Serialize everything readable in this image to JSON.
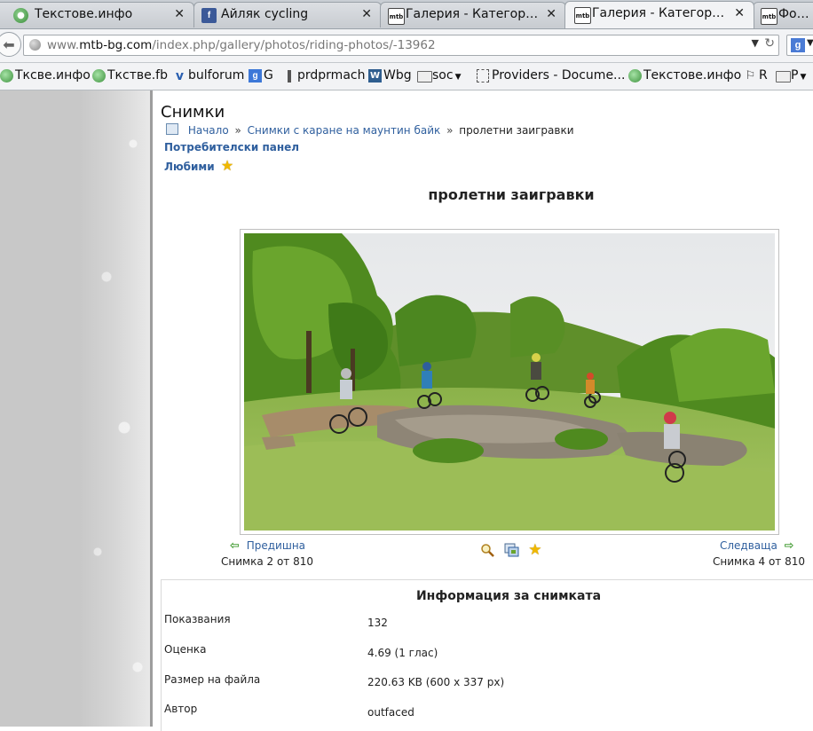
{
  "browser": {
    "tabs": [
      {
        "title": "Текстове.инфо",
        "icon": "globe-icon",
        "active": false
      },
      {
        "title": "Айляк cycling",
        "icon": "facebook-icon",
        "active": false
      },
      {
        "title": "Галерия - Категории - mtb-bg.com",
        "icon": "mtb-icon",
        "active": false
      },
      {
        "title": "Галерия - Категории - mtb-bg.com",
        "icon": "mtb-icon",
        "active": true
      },
      {
        "title": "Форум",
        "icon": "mtb-icon",
        "active": false
      }
    ],
    "url_prefix": "www.",
    "url_domain": "mtb-bg.com",
    "url_path": "/index.php/gallery/photos/riding-photos/-13962",
    "search_engine_label": "g",
    "bookmarks": [
      {
        "label": "Ткcве.инфо",
        "icon": "globe-icon"
      },
      {
        "label": "Ткcтве.fb",
        "icon": "globe-icon"
      },
      {
        "label": "bulforum",
        "icon": "v-icon"
      },
      {
        "label": "G",
        "icon": "google-icon"
      },
      {
        "label": "prdprmach",
        "icon": "bar-icon"
      },
      {
        "label": "Wbg",
        "icon": "w-icon"
      },
      {
        "label": "soc",
        "icon": "folder-icon",
        "dropdown": true
      },
      {
        "label": "Providers - Docume...",
        "icon": "document-icon"
      },
      {
        "label": "Текстове.инфо",
        "icon": "globe-icon"
      },
      {
        "label": "R",
        "icon": "r-icon"
      },
      {
        "label": "P",
        "icon": "folder-icon",
        "dropdown": true
      }
    ]
  },
  "page": {
    "title": "Снимки",
    "breadcrumb": {
      "home": "Начало",
      "category": "Снимки с каране на маунтин байк",
      "current": "пролетни заигравки",
      "separator": "»"
    },
    "user_panel_link": "Потребителски панел",
    "favorites_link": "Любими",
    "photo_title": "пролетни заигравки",
    "nav": {
      "prev_label": "Предишна",
      "next_label": "Следваща",
      "prev_count": "Снимка 2 от 810",
      "next_count": "Снимка 4 от 810"
    },
    "info": {
      "heading": "Информация за снимката",
      "rows": [
        {
          "label": "Показвания",
          "value": "132"
        },
        {
          "label": "Оценка",
          "value": "4.69 (1 глас)"
        },
        {
          "label": "Размер на файла",
          "value": "220.63 KB (600 x 337 px)"
        },
        {
          "label": "Автор",
          "value": "outfaced"
        }
      ]
    }
  },
  "colors": {
    "link": "#2f5f9e",
    "star": "#f0b800",
    "arrow": "#3f9a2f"
  }
}
